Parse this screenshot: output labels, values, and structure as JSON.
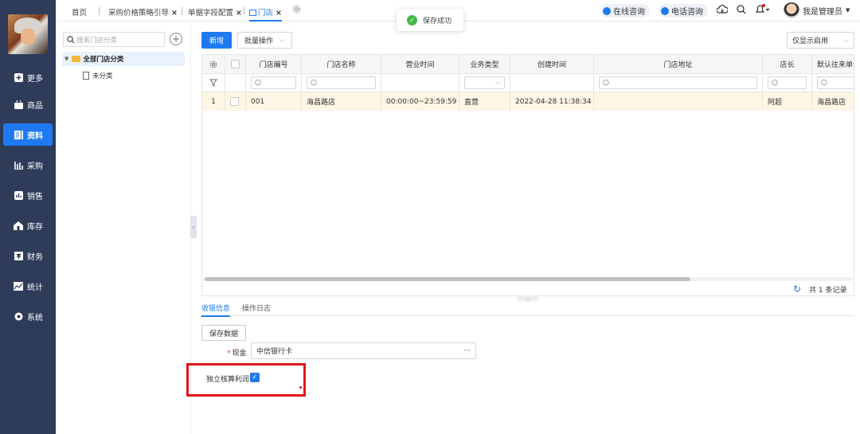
{
  "sidebar": {
    "items": [
      {
        "label": "更多",
        "icon": "plus-square-icon"
      },
      {
        "label": "商品",
        "icon": "bag-icon"
      },
      {
        "label": "资料",
        "icon": "document-icon",
        "active": true
      },
      {
        "label": "采购",
        "icon": "chart-icon"
      },
      {
        "label": "销售",
        "icon": "bar-chart-icon"
      },
      {
        "label": "库存",
        "icon": "house-icon"
      },
      {
        "label": "财务",
        "icon": "finance-icon"
      },
      {
        "label": "统计",
        "icon": "stats-icon"
      },
      {
        "label": "系统",
        "icon": "gear-icon"
      }
    ]
  },
  "tabs": [
    {
      "label": "首页"
    },
    {
      "label": "采购价格策略引导",
      "close": "×"
    },
    {
      "label": "单据字段配置",
      "close": "×"
    },
    {
      "label": "门店",
      "close": "×",
      "active": true
    }
  ],
  "toast": {
    "message": "保存成功"
  },
  "header": {
    "online": "在线咨询",
    "phone": "电话咨询",
    "user": "我是管理员"
  },
  "tree": {
    "search_placeholder": "搜索门店分类",
    "root": "全部门店分类",
    "child": "未分类"
  },
  "toolbar": {
    "add_label": "新增",
    "batch_label": "批量操作",
    "filter_value": "仅显示启用"
  },
  "table": {
    "columns": [
      "门店编号",
      "门店名称",
      "营业时间",
      "业务类型",
      "创建时间",
      "门店地址",
      "店长",
      "默认往来单位"
    ],
    "rows": [
      {
        "index": "1",
        "code": "001",
        "name": "海昌路店",
        "hours": "00:00:00~23:59:59",
        "type": "直营",
        "created": "2022-04-28 11:38:34",
        "address": "",
        "manager": "阿超",
        "partner": "海昌路店"
      }
    ],
    "record_count": "共 1 条记录"
  },
  "detail": {
    "tab_info": "收银信息",
    "tab_log": "操作日志",
    "save_label": "保存数据",
    "cash_label": "现金",
    "cash_value": "中信银行卡",
    "cash_more": "···",
    "profit_label": "独立核算利润"
  },
  "colors": {
    "accent": "#1f7af2",
    "sidebar": "#2e3c5a",
    "highlight": "#e0161b"
  }
}
